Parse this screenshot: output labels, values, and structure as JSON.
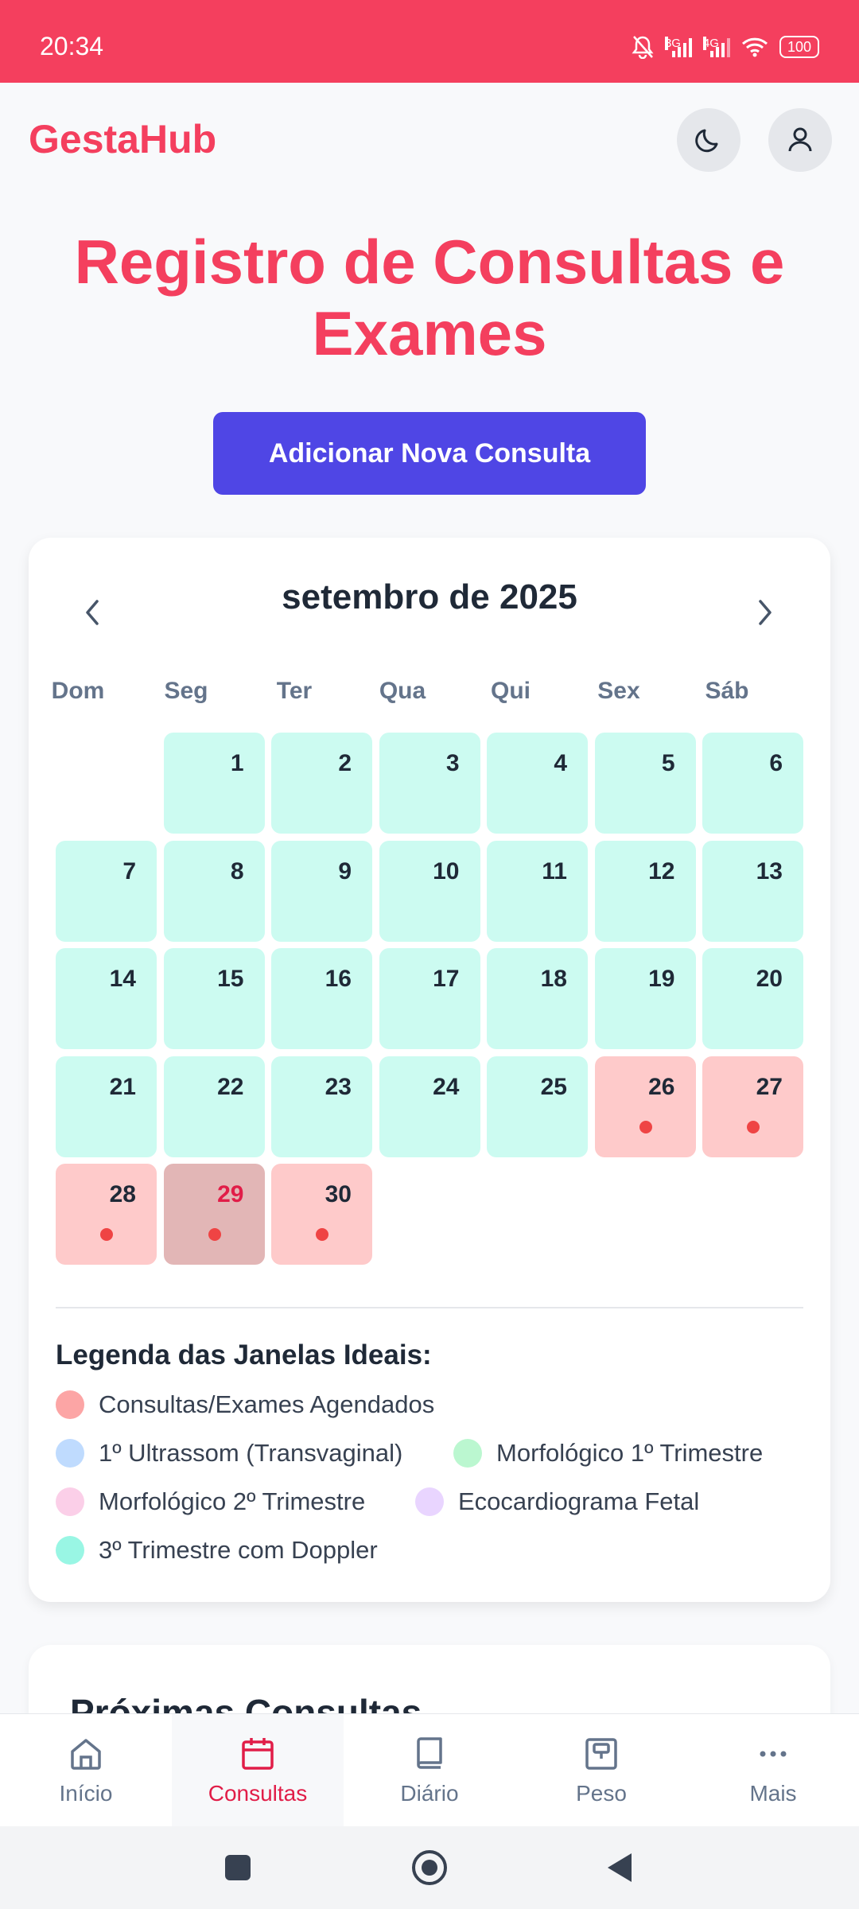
{
  "status": {
    "time": "20:34",
    "net1": "3G",
    "net2": "4G",
    "battery": "100"
  },
  "header": {
    "logo": "GestaHub",
    "theme_icon": "moon-icon",
    "profile_icon": "user-icon"
  },
  "page": {
    "title": "Registro de Consultas e Exames",
    "add_button": "Adicionar Nova Consulta"
  },
  "calendar": {
    "month_label": "setembro de 2025",
    "weekdays": [
      "Dom",
      "Seg",
      "Ter",
      "Qua",
      "Qui",
      "Sex",
      "Sáb"
    ],
    "leading_blanks": 1,
    "days": [
      {
        "n": "1",
        "s": "ideal"
      },
      {
        "n": "2",
        "s": "ideal"
      },
      {
        "n": "3",
        "s": "ideal"
      },
      {
        "n": "4",
        "s": "ideal"
      },
      {
        "n": "5",
        "s": "ideal"
      },
      {
        "n": "6",
        "s": "ideal"
      },
      {
        "n": "7",
        "s": "ideal"
      },
      {
        "n": "8",
        "s": "ideal"
      },
      {
        "n": "9",
        "s": "ideal"
      },
      {
        "n": "10",
        "s": "ideal"
      },
      {
        "n": "11",
        "s": "ideal"
      },
      {
        "n": "12",
        "s": "ideal"
      },
      {
        "n": "13",
        "s": "ideal"
      },
      {
        "n": "14",
        "s": "ideal"
      },
      {
        "n": "15",
        "s": "ideal"
      },
      {
        "n": "16",
        "s": "ideal"
      },
      {
        "n": "17",
        "s": "ideal"
      },
      {
        "n": "18",
        "s": "ideal"
      },
      {
        "n": "19",
        "s": "ideal"
      },
      {
        "n": "20",
        "s": "ideal"
      },
      {
        "n": "21",
        "s": "ideal"
      },
      {
        "n": "22",
        "s": "ideal"
      },
      {
        "n": "23",
        "s": "ideal"
      },
      {
        "n": "24",
        "s": "ideal"
      },
      {
        "n": "25",
        "s": "ideal"
      },
      {
        "n": "26",
        "s": "sched"
      },
      {
        "n": "27",
        "s": "sched"
      },
      {
        "n": "28",
        "s": "sched"
      },
      {
        "n": "29",
        "s": "today"
      },
      {
        "n": "30",
        "s": "sched"
      }
    ]
  },
  "legend": {
    "title": "Legenda das Janelas Ideais:",
    "items": [
      {
        "label": "Consultas/Exames Agendados",
        "color": "#fca5a5"
      },
      {
        "label": "1º Ultrassom (Transvaginal)",
        "color": "#bfdbfe"
      },
      {
        "label": "Morfológico 1º Trimestre",
        "color": "#bbf7d0"
      },
      {
        "label": "Morfológico 2º Trimestre",
        "color": "#fbcfe8"
      },
      {
        "label": "Ecocardiograma Fetal",
        "color": "#e9d5ff"
      },
      {
        "label": "3º Trimestre com Doppler",
        "color": "#99f6e4"
      }
    ]
  },
  "next_section": {
    "title": "Próximas Consultas"
  },
  "nav": {
    "items": [
      {
        "label": "Início",
        "icon": "home-icon"
      },
      {
        "label": "Consultas",
        "icon": "calendar-icon",
        "active": true
      },
      {
        "label": "Diário",
        "icon": "book-icon"
      },
      {
        "label": "Peso",
        "icon": "scale-icon"
      },
      {
        "label": "Mais",
        "icon": "more-icon"
      }
    ]
  },
  "colors": {
    "brand": "#f43f5e",
    "primary": "#4f46e5",
    "ideal_window": "#ccfbf1",
    "scheduled": "#fecaca"
  }
}
